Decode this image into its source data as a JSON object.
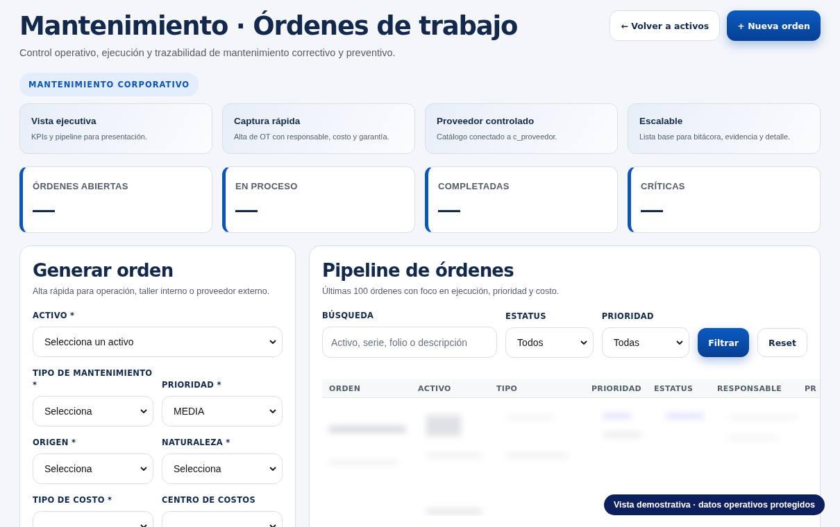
{
  "header": {
    "title": "Mantenimiento · Órdenes de trabajo",
    "subtitle": "Control operativo, ejecución y trazabilidad de mantenimiento correctivo y preventivo.",
    "back_button": "← Volver a activos",
    "new_button": "+ Nueva orden"
  },
  "badge": "MANTENIMIENTO CORPORATIVO",
  "features": [
    {
      "title": "Vista ejecutiva",
      "text": "KPIs y pipeline para presentación."
    },
    {
      "title": "Captura rápida",
      "text": "Alta de OT con responsable, costo y garantía."
    },
    {
      "title": "Proveedor controlado",
      "text": "Catálogo conectado a c_proveedor."
    },
    {
      "title": "Escalable",
      "text": "Lista base para bitácora, evidencia y detalle."
    }
  ],
  "kpis": [
    {
      "label": "ÓRDENES ABIERTAS",
      "value": "—"
    },
    {
      "label": "EN PROCESO",
      "value": "—"
    },
    {
      "label": "COMPLETADAS",
      "value": "—"
    },
    {
      "label": "CRÍTICAS",
      "value": "—"
    }
  ],
  "form": {
    "title": "Generar orden",
    "subtitle": "Alta rápida para operación, taller interno o proveedor externo.",
    "fields": [
      {
        "label": "ACTIVO *",
        "value": "Selecciona un activo",
        "full": true
      },
      {
        "label": "TIPO DE MANTENIMIENTO *",
        "value": "Selecciona",
        "full": false
      },
      {
        "label": "PRIORIDAD *",
        "value": "MEDIA",
        "full": false
      },
      {
        "label": "ORIGEN *",
        "value": "Selecciona",
        "full": false
      },
      {
        "label": "NATURALEZA *",
        "value": "Selecciona",
        "full": false
      },
      {
        "label": "TIPO DE COSTO *",
        "full": false
      },
      {
        "label": "CENTRO DE COSTOS",
        "full": false
      }
    ]
  },
  "pipeline": {
    "title": "Pipeline de órdenes",
    "subtitle": "Últimas 100 órdenes con foco en ejecución, prioridad y costo.",
    "search": {
      "label": "BÚSQUEDA",
      "placeholder": "Activo, serie, folio o descripción"
    },
    "status": {
      "label": "ESTATUS",
      "value": "Todos"
    },
    "priority": {
      "label": "PRIORIDAD",
      "value": "Todas"
    },
    "filter_button": "Filtrar",
    "reset_button": "Reset",
    "table": {
      "columns": [
        "ORDEN",
        "ACTIVO",
        "TIPO",
        "PRIORIDAD",
        "ESTATUS",
        "RESPONSABLE",
        "PR"
      ]
    }
  },
  "toast": "Vista demostrativa · datos operativos protegidos"
}
